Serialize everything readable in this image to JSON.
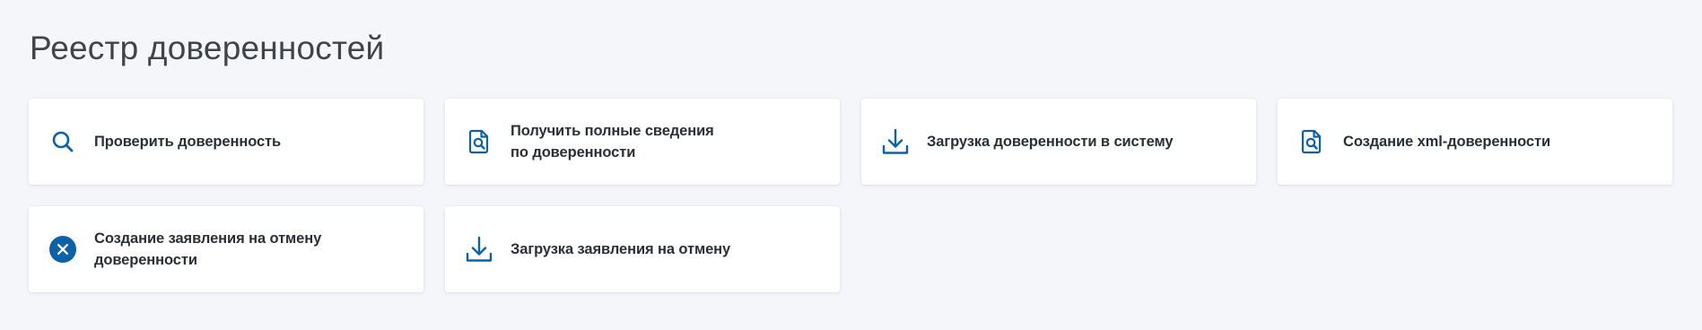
{
  "page": {
    "title": "Реестр доверенностей"
  },
  "colors": {
    "accent": "#0b62a8",
    "background": "#f5f6fa",
    "card": "#ffffff",
    "text": "#2a2f36",
    "title": "#404449"
  },
  "cards": [
    {
      "label": "Проверить доверенность",
      "icon": "search-icon"
    },
    {
      "label": "Получить полные сведения\nпо доверенности",
      "icon": "document-search-icon"
    },
    {
      "label": "Загрузка доверенности в систему",
      "icon": "download-icon"
    },
    {
      "label": "Создание xml-доверенности",
      "icon": "document-search-icon"
    },
    {
      "label": "Создание заявления на отмену доверенности",
      "icon": "cancel-circle-icon"
    },
    {
      "label": "Загрузка заявления на отмену",
      "icon": "download-icon"
    }
  ]
}
